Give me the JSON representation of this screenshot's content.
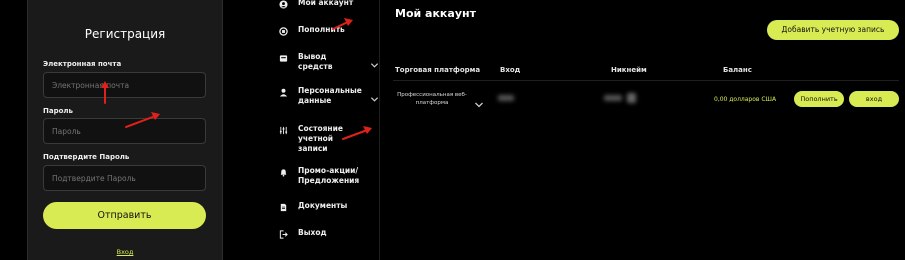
{
  "registration": {
    "title": "Регистрация",
    "email_label": "Электронная почта",
    "email_placeholder": "Электронная почта",
    "password_label": "Пароль",
    "password_placeholder": "Пароль",
    "confirm_label": "Подтвердите Пароль",
    "confirm_placeholder": "Подтвердите Пароль",
    "submit_label": "Отправить",
    "login_link": "Вход"
  },
  "sidebar": {
    "items": [
      {
        "label": "Мой аккаунт",
        "icon": "user-circle-icon"
      },
      {
        "label": "Пополнить",
        "icon": "deposit-icon"
      },
      {
        "label": "Вывод средств",
        "icon": "withdraw-icon"
      },
      {
        "label": "Персональные данные",
        "icon": "user-icon"
      },
      {
        "label": "Состояние учетной записи",
        "icon": "sliders-icon"
      },
      {
        "label": "Промо-акции/ Предложения",
        "icon": "bell-icon"
      },
      {
        "label": "Документы",
        "icon": "document-icon"
      },
      {
        "label": "Выход",
        "icon": "logout-icon"
      }
    ]
  },
  "account": {
    "title": "Мой аккаунт",
    "add_button": "Добавить учетную запись",
    "columns": {
      "platform": "Торговая платформа",
      "login": "Вход",
      "nickname": "Никнейм",
      "balance": "Баланс"
    },
    "row": {
      "platform": "Профессиональная веб-платформа",
      "balance": "0,00 долларов США",
      "deposit_button": "Пополнить",
      "login_button": "вход"
    }
  },
  "colors": {
    "accent": "#d9eb52",
    "background": "#000000",
    "panel": "#1a1a1a",
    "annotation": "#e0201b"
  }
}
